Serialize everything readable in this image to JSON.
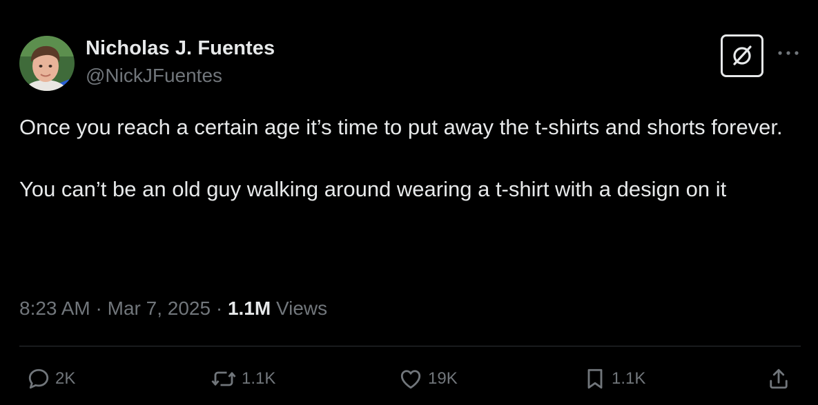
{
  "author": {
    "display_name": "Nicholas J. Fuentes",
    "handle": "@NickJFuentes",
    "avatar_icon": "profile-photo"
  },
  "header_actions": {
    "grok_icon": "grok-icon",
    "more_icon": "more-horizontal-icon"
  },
  "tweet": {
    "paragraphs": [
      "Once you reach a certain age it’s time to put away the t-shirts and shorts forever.",
      "You can’t be an old guy walking around wearing a t-shirt with a design on it"
    ],
    "time": "8:23 AM",
    "sep1": "·",
    "date": "Mar 7, 2025",
    "sep2": "·",
    "views_count": "1.1M",
    "views_label": "Views"
  },
  "actions": {
    "reply": {
      "icon": "reply-icon",
      "count": "2K"
    },
    "repost": {
      "icon": "repost-icon",
      "count": "1.1K"
    },
    "like": {
      "icon": "heart-icon",
      "count": "19K"
    },
    "bookmark": {
      "icon": "bookmark-icon",
      "count": "1.1K"
    },
    "share": {
      "icon": "share-icon"
    }
  },
  "colors": {
    "background": "#000000",
    "primary_text": "#e7e9ea",
    "secondary_text": "#71767b",
    "divider": "#2f3336"
  }
}
